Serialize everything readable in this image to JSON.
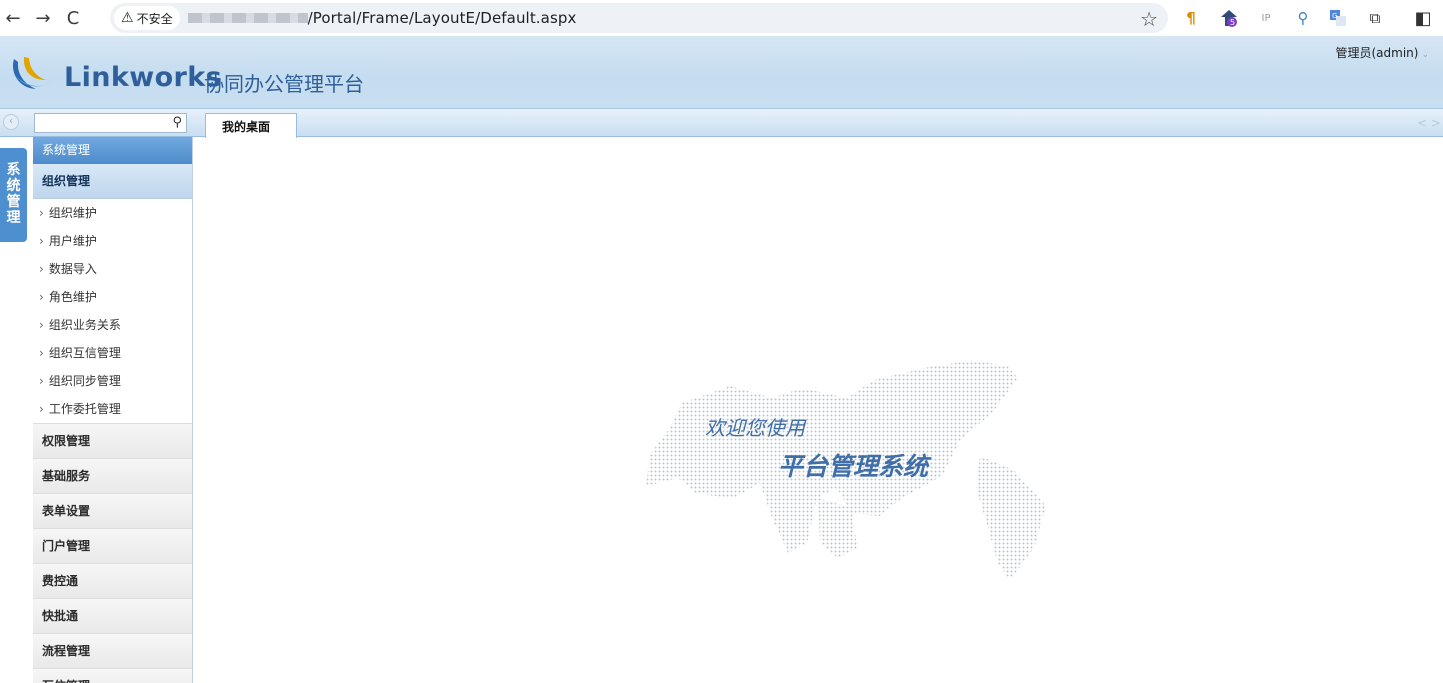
{
  "browser": {
    "security": "不安全",
    "url_path": "/Portal/Frame/LayoutE/Default.aspx",
    "back_glyph": "←",
    "forward_glyph": "→",
    "reload_glyph": "C",
    "warning_glyph": "⚠",
    "star_glyph": "☆"
  },
  "header": {
    "logo_word": "Linkworks",
    "logo_subtitle": "协同办公管理平台",
    "user": "管理员(admin)"
  },
  "tabs": {
    "active": "我的桌面",
    "nav": "< >"
  },
  "sidebar": {
    "vertical_tab": [
      "系",
      "统",
      "管",
      "理"
    ],
    "group": "系统管理",
    "subgroup": "组织管理",
    "items": [
      "组织维护",
      "用户维护",
      "数据导入",
      "角色维护",
      "组织业务关系",
      "组织互信管理",
      "组织同步管理",
      "工作委托管理"
    ],
    "sections": [
      "权限管理",
      "基础服务",
      "表单设置",
      "门户管理",
      "费控通",
      "快批通",
      "流程管理",
      "互信管理"
    ]
  },
  "main": {
    "welcome_line1": "欢迎您使用",
    "welcome_line2": "平台管理系统"
  },
  "colors": {
    "brand": "#2f5f9a",
    "accent": "#4d8bcb"
  }
}
